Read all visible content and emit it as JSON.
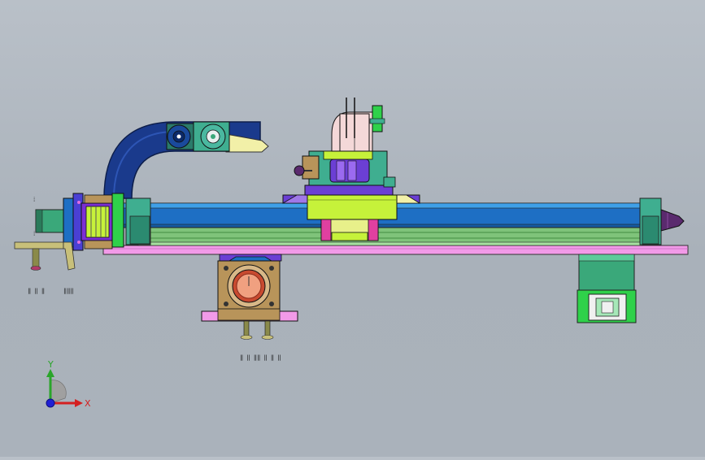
{
  "view": {
    "background_color": "#b3bbc4",
    "axis_triad": {
      "x_label": "X",
      "y_label": "Y",
      "x_color": "#d42020",
      "y_color": "#2aa52a",
      "z_color": "#2020d4"
    }
  },
  "colors": {
    "base_plate": "#f29ae8",
    "rail_body": "#1e6fc4",
    "rail_top": "#3fa0e8",
    "carriage": "#c6f23a",
    "cable_chain": "#1a3a8c",
    "motor_housing": "#3aa87a",
    "bracket_green": "#2fd14a",
    "coupling_purple": "#7b2fd4",
    "bearing_bronze": "#b8945a"
  },
  "icons": [
    "x-axis-arrow-icon",
    "y-axis-arrow-icon",
    "z-axis-origin-icon"
  ]
}
